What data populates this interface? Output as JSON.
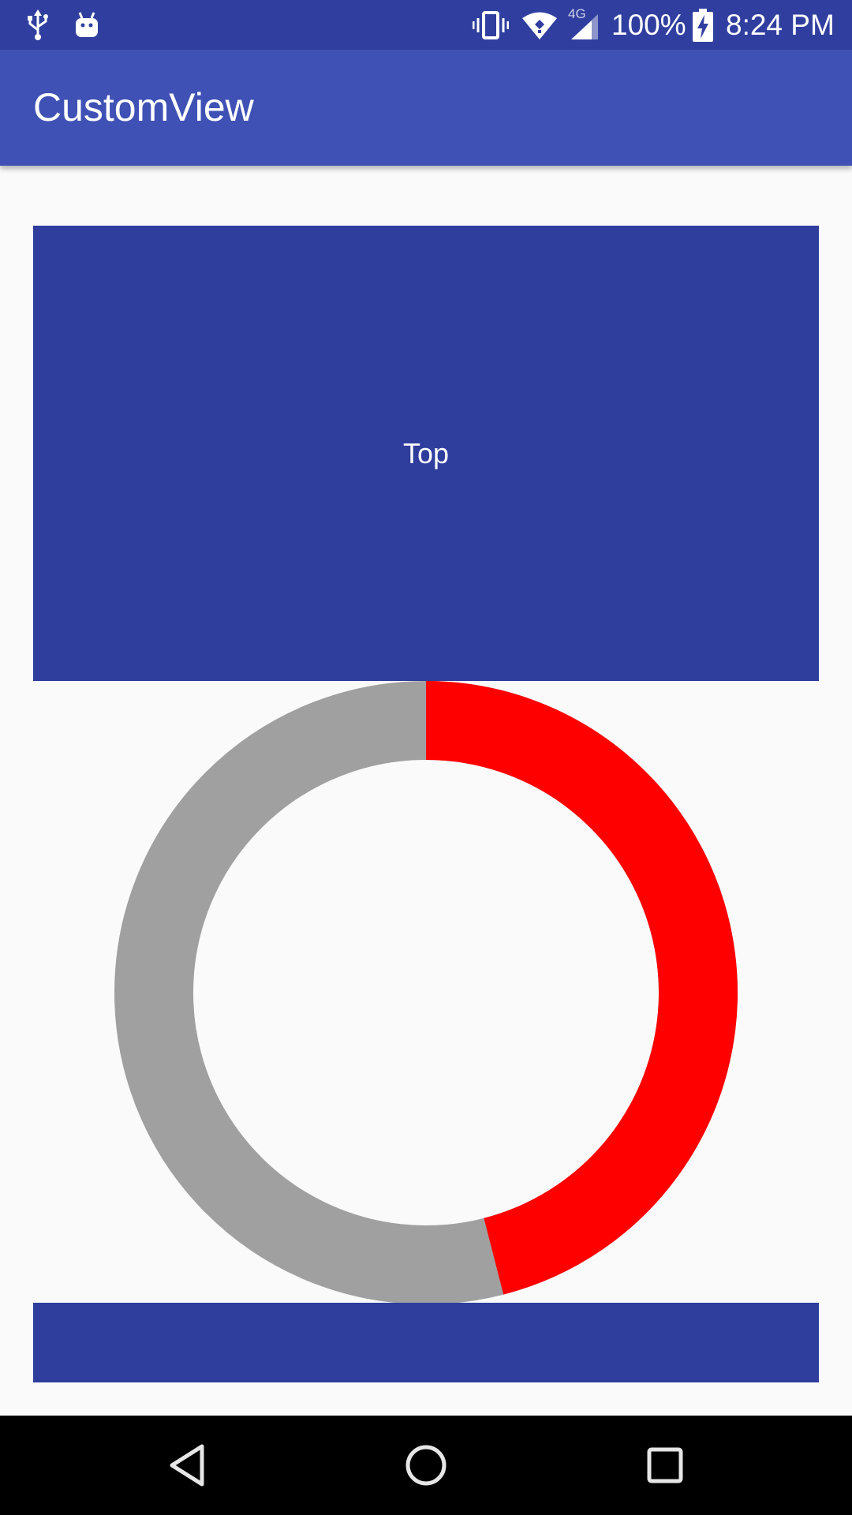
{
  "status_bar": {
    "icons_left": [
      "usb-icon",
      "android-debug-icon"
    ],
    "icons_right": [
      "vibrate-icon",
      "wifi-icon",
      "cellular-4g-icon",
      "battery-charging-icon"
    ],
    "network_label": "4G",
    "battery": "100%",
    "time": "8:24 PM"
  },
  "app_bar": {
    "title": "CustomView"
  },
  "content": {
    "top_label": "Top",
    "ring": {
      "progress_fraction": 0.46,
      "progress_color": "#ff0000",
      "track_color": "#a0a0a0"
    },
    "block_color": "#2f3d9d"
  },
  "nav_bar": {
    "buttons": [
      "back-icon",
      "home-icon",
      "recents-icon"
    ]
  },
  "colors": {
    "status_bar": "#303f9f",
    "app_bar": "#3f51b5",
    "background": "#fafafa"
  }
}
